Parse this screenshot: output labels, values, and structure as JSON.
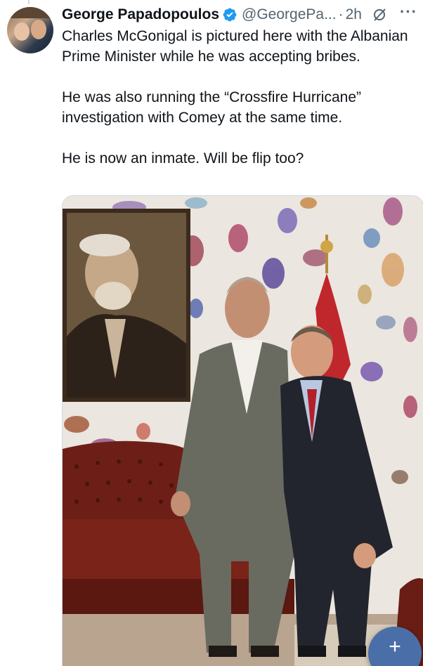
{
  "tweet": {
    "display_name": "George Papadopoulos",
    "handle": "@GeorgePa...",
    "separator": "·",
    "time": "2h",
    "verified": true,
    "paragraphs": [
      "Charles McGonigal is pictured here with the Albanian Prime Minister while he was accepting bribes.",
      "He was also running the “Crossfire Hurricane” investigation with Comey at the same time.",
      "He is now an inmate. Will be flip too?"
    ],
    "more_label": "···"
  },
  "fab": {
    "label": "+"
  },
  "colors": {
    "text_primary": "#0f1419",
    "text_secondary": "#536471",
    "verified_blue": "#1d9bf0",
    "fab": "#4a6fa8"
  },
  "icons": {
    "verified": "verified-badge-icon",
    "grok": "grok-icon",
    "more": "more-icon",
    "compose": "plus-icon"
  }
}
